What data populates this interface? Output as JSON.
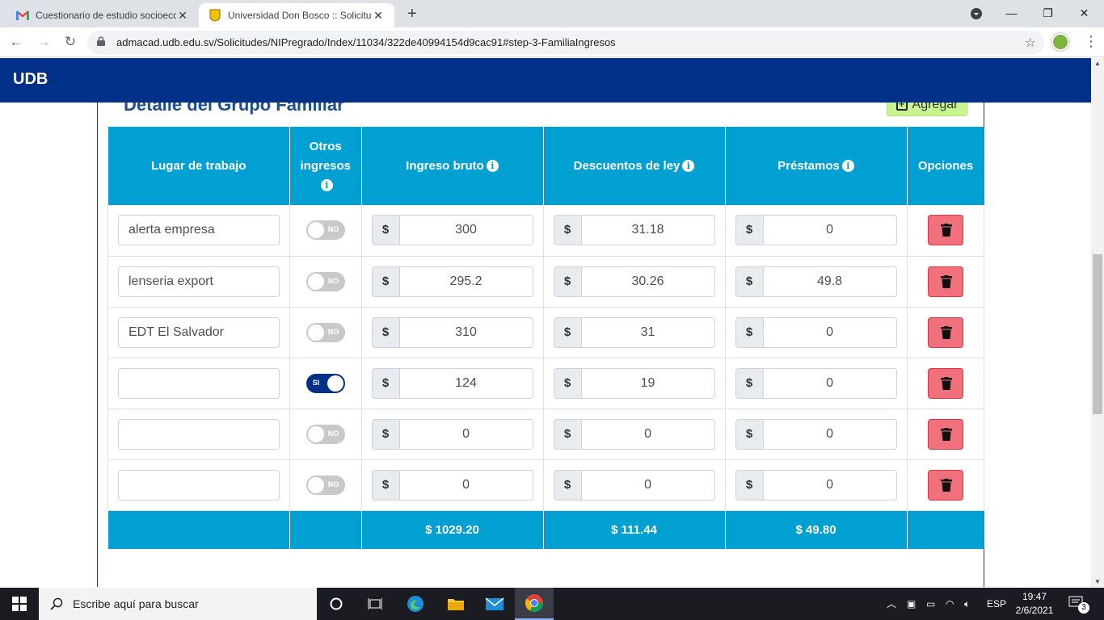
{
  "browser": {
    "tabs": [
      {
        "title": "Cuestionario de estudio socioeco",
        "favicon": "gmail-icon"
      },
      {
        "title": "Universidad Don Bosco :: Solicitu",
        "favicon": "udb-icon"
      }
    ],
    "url": "admacad.udb.edu.sv/Solicitudes/NIPregrado/Index/11034/322de40994154d9cac91#step-3-FamiliaIngresos"
  },
  "header": {
    "brand": "UDB"
  },
  "section": {
    "title": "Detalle del Grupo Familiar",
    "add_label": "Agregar"
  },
  "table": {
    "columns": [
      "Lugar de trabajo",
      "Otros ingresos",
      "Ingreso bruto",
      "Descuentos de ley",
      "Préstamos",
      "Opciones"
    ],
    "currency": "$",
    "rows": [
      {
        "lugar": "alerta empresa",
        "otros": "NO",
        "bruto": "300",
        "descuentos": "31.18",
        "prestamos": "0"
      },
      {
        "lugar": "lenseria export",
        "otros": "NO",
        "bruto": "295.2",
        "descuentos": "30.26",
        "prestamos": "49.8"
      },
      {
        "lugar": "EDT El Salvador",
        "otros": "NO",
        "bruto": "310",
        "descuentos": "31",
        "prestamos": "0"
      },
      {
        "lugar": "",
        "otros": "SI",
        "bruto": "124",
        "descuentos": "19",
        "prestamos": "0"
      },
      {
        "lugar": "",
        "otros": "NO",
        "bruto": "0",
        "descuentos": "0",
        "prestamos": "0"
      },
      {
        "lugar": "",
        "otros": "NO",
        "bruto": "0",
        "descuentos": "0",
        "prestamos": "0"
      }
    ],
    "totals": {
      "bruto": "$ 1029.20",
      "descuentos": "$ 111.44",
      "prestamos": "$ 49.80"
    }
  },
  "taskbar": {
    "search_placeholder": "Escribe aquí para buscar",
    "language": "ESP",
    "time": "19:47",
    "date": "2/6/2021",
    "notifications": "3"
  },
  "colors": {
    "header": "#003087",
    "table_header": "#00a0d2",
    "add_button": "#c8f58f",
    "delete_button": "#f0717c"
  }
}
